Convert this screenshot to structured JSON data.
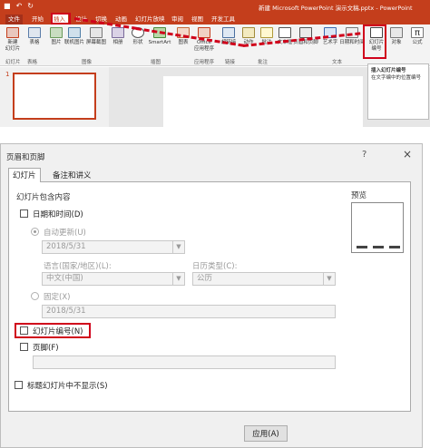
{
  "ppt": {
    "doc_title": "新建 Microsoft PowerPoint 演示文稿.pptx - PowerPoint",
    "tabs": {
      "file": "文件",
      "home": "开始",
      "insert": "插入",
      "design": "设计",
      "transitions": "切换",
      "animations": "动画",
      "slideshow": "幻灯片放映",
      "review": "审阅",
      "view": "视图",
      "developer": "开发工具"
    },
    "ribbon": {
      "new_slide": "新建\n幻灯片",
      "table": "表格",
      "picture": "图片",
      "online_picture": "联机图片",
      "screenshot": "屏幕截图",
      "album": "相册",
      "shapes": "形状",
      "smartart": "SmartArt",
      "chart": "图表",
      "office_apps": "Office\n应用程序",
      "hyperlink": "超链接",
      "action": "动作",
      "comment": "批注",
      "textbox": "文本框",
      "header_footer": "页眉和页脚",
      "wordart": "艺术字",
      "datetime": "日期和时间",
      "slide_number": "幻灯片\n编号",
      "object": "对象",
      "formula": "公式"
    },
    "groups": {
      "slides": "幻灯片",
      "tables": "表格",
      "images": "图像",
      "illustrations": "插图",
      "apps": "应用程序",
      "links": "链接",
      "comments": "批注",
      "text": "文本"
    },
    "slide_thumb_number": "1",
    "tooltip": {
      "title": "插入幻灯片编号",
      "body": "在文字编中的位置编号"
    }
  },
  "dialog": {
    "title": "页眉和页脚",
    "help": "?",
    "close": "×",
    "tab_slide": "幻灯片",
    "tab_notes": "备注和讲义",
    "include_group": "幻灯片包含内容",
    "datetime_label": "日期和时间(D)",
    "auto_update_label": "自动更新(U)",
    "auto_date_value": "2018/5/31",
    "language_label": "语言(国家/地区)(L):",
    "language_value": "中文(中国)",
    "calendar_label": "日历类型(C):",
    "calendar_value": "公历",
    "fixed_label": "固定(X)",
    "fixed_value": "2018/5/31",
    "slide_number_label": "幻灯片编号(N)",
    "footer_label": "页脚(F)",
    "footer_value": "",
    "hide_title_label": "标题幻灯片中不显示(S)",
    "preview_label": "预览",
    "apply_label": "应用(A)"
  },
  "colors": {
    "ppt_accent": "#c43e1c",
    "highlight_red": "#d0021b"
  }
}
